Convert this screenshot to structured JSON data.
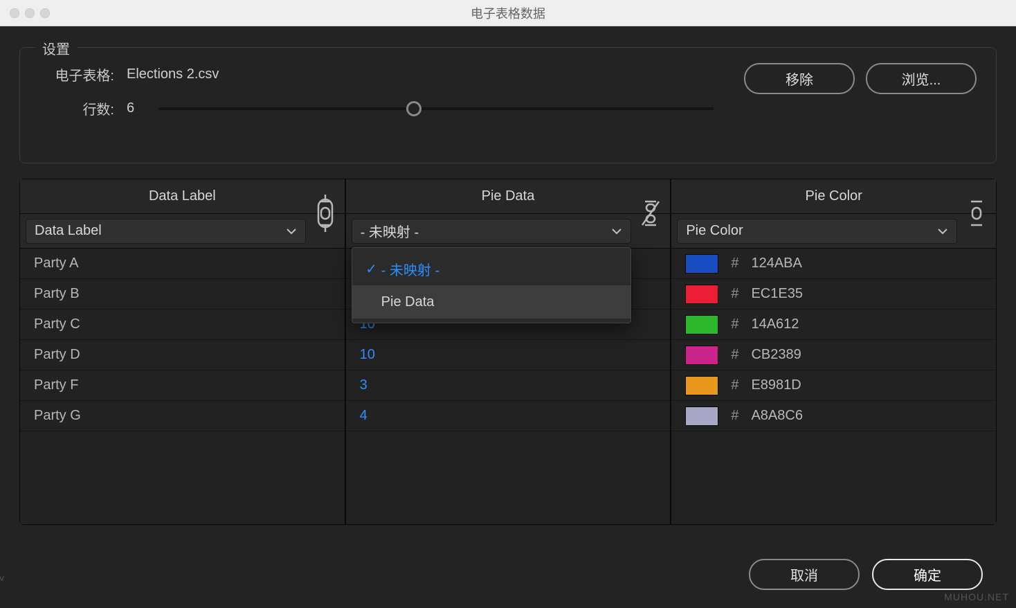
{
  "window": {
    "title": "电子表格数据"
  },
  "settings": {
    "legend": "设置",
    "spreadsheet_label": "电子表格:",
    "spreadsheet_value": "Elections 2.csv",
    "rows_label": "行数:",
    "rows_value": "6",
    "remove_label": "移除",
    "browse_label": "浏览..."
  },
  "columns": [
    {
      "header": "Data Label",
      "mapping_selected": "Data Label",
      "link_broken": false
    },
    {
      "header": "Pie Data",
      "mapping_selected": "- 未映射 -",
      "link_broken": true
    },
    {
      "header": "Pie Color",
      "mapping_selected": "Pie Color",
      "link_broken": false
    }
  ],
  "dropdown": {
    "options": [
      {
        "label": "- 未映射 -",
        "checked": true
      },
      {
        "label": "Pie Data",
        "checked": false
      }
    ]
  },
  "rows": [
    {
      "label": "Party A",
      "data": "",
      "color_hex": "124ABA",
      "color_css": "#1a4dc2"
    },
    {
      "label": "Party B",
      "data": "",
      "color_hex": "EC1E35",
      "color_css": "#ec1e35"
    },
    {
      "label": "Party C",
      "data": "10",
      "color_hex": "14A612",
      "color_css": "#2db82b"
    },
    {
      "label": "Party D",
      "data": "10",
      "color_hex": "CB2389",
      "color_css": "#cb2389"
    },
    {
      "label": "Party F",
      "data": "3",
      "color_hex": "E8981D",
      "color_css": "#e8981d"
    },
    {
      "label": "Party G",
      "data": "4",
      "color_hex": "A8A8C6",
      "color_css": "#a8a8c6"
    }
  ],
  "buttons": {
    "cancel": "取消",
    "ok": "确定"
  },
  "watermark": "MUHOU.NET"
}
